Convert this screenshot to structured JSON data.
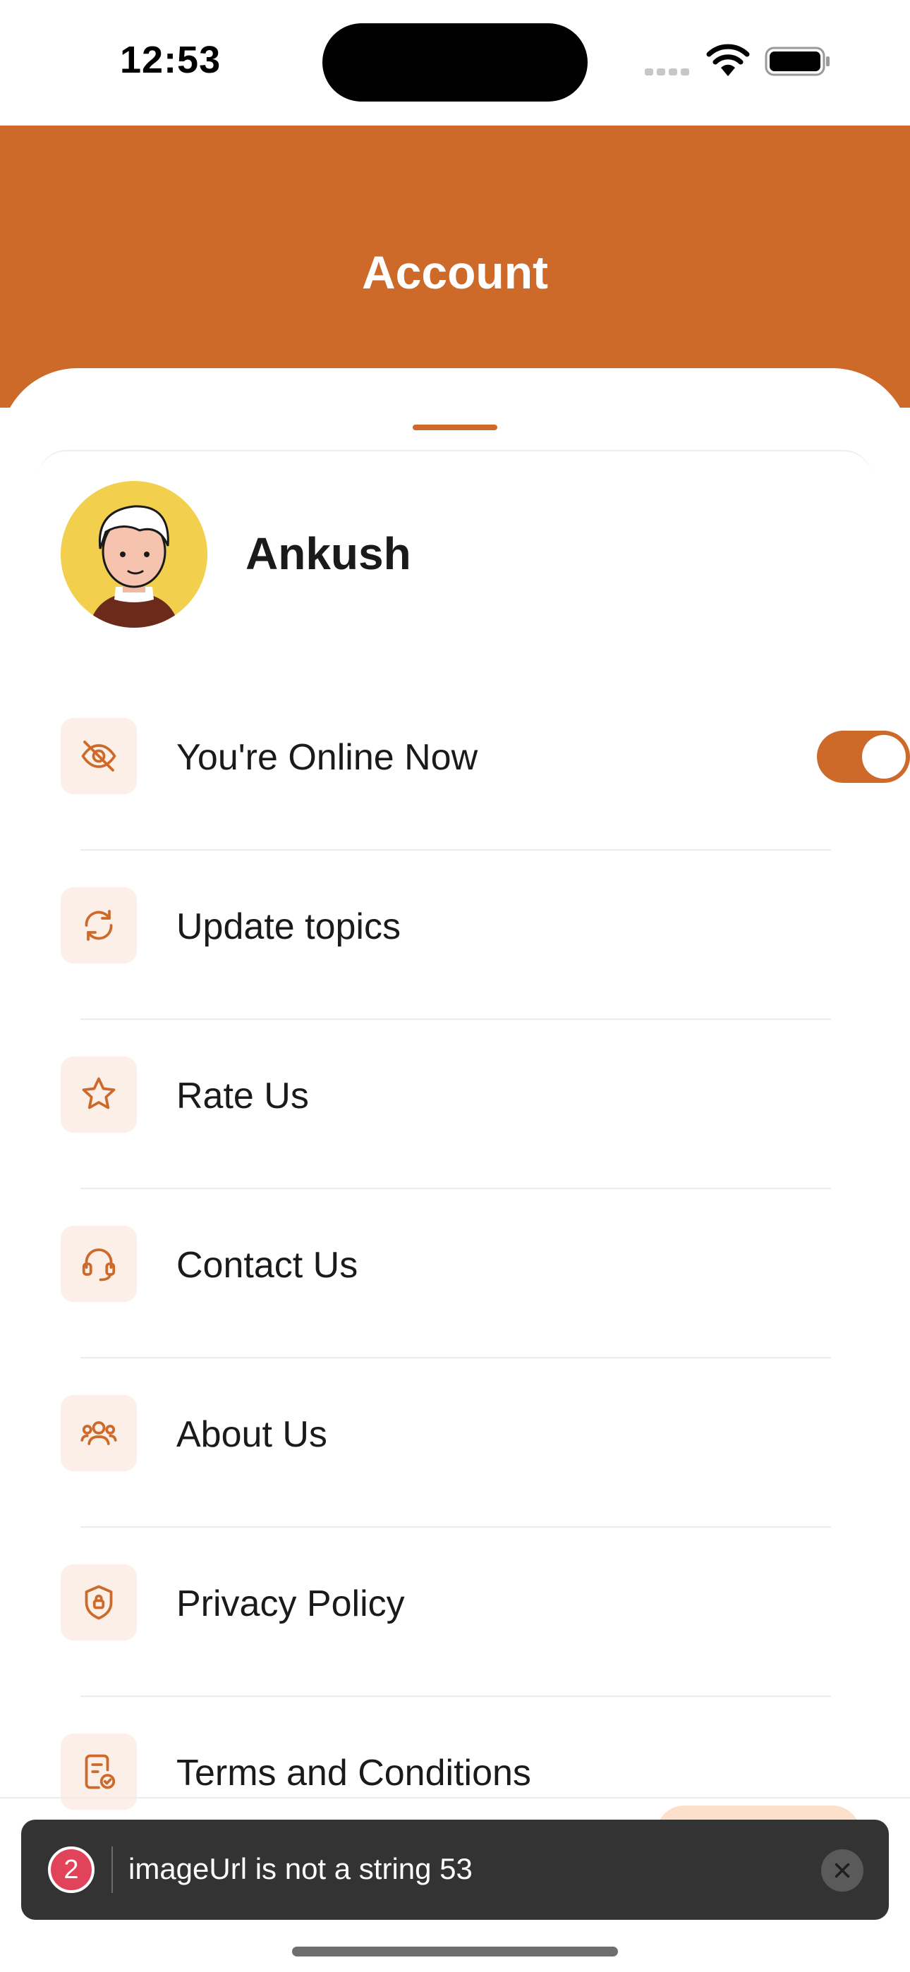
{
  "status_bar": {
    "time": "12:53"
  },
  "header": {
    "title": "Account"
  },
  "profile": {
    "name": "Ankush"
  },
  "menu": [
    {
      "label": "You're Online Now",
      "icon": "eye-off-icon",
      "toggle_on": true
    },
    {
      "label": "Update topics",
      "icon": "refresh-icon"
    },
    {
      "label": "Rate Us",
      "icon": "star-icon"
    },
    {
      "label": "Contact Us",
      "icon": "headset-icon"
    },
    {
      "label": "About Us",
      "icon": "users-icon"
    },
    {
      "label": "Privacy Policy",
      "icon": "shield-lock-icon"
    },
    {
      "label": "Terms and Conditions",
      "icon": "document-check-icon"
    }
  ],
  "toast": {
    "count": "2",
    "message": "imageUrl is not a string 53"
  },
  "colors": {
    "accent": "#cd6a2a",
    "icon_bg": "#fcefe8",
    "toast_bg": "#333333",
    "badge": "#e0435a"
  }
}
